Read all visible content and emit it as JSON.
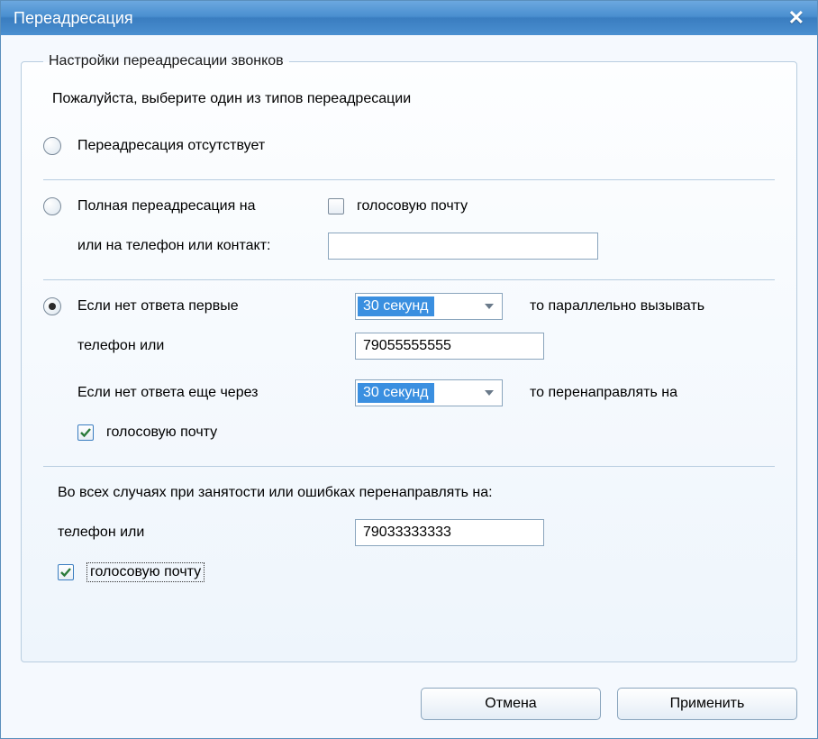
{
  "window": {
    "title": "Переадресация"
  },
  "group": {
    "legend": "Настройки переадресации звонков",
    "instruction": "Пожалуйста, выберите один из типов переадресации"
  },
  "option_none": {
    "label": "Переадресация отсутствует",
    "selected": false
  },
  "option_full": {
    "label": "Полная переадресация  на",
    "sub_label": "или на телефон или контакт:",
    "voicemail_checkbox": "голосовую почту",
    "voicemail_checked": false,
    "phone_value": "",
    "selected": false
  },
  "option_noanswer": {
    "line1_prefix": "Если нет ответа первые",
    "line1_suffix": "то параллельно вызывать",
    "timeout1": "30 секунд",
    "line2_label": "телефон или",
    "phone1_value": "79055555555",
    "line3_prefix": "Если нет ответа еще через",
    "line3_suffix": "то перенаправлять на",
    "timeout2": "30 секунд",
    "voicemail_checkbox": "голосовую почту",
    "voicemail_checked": true,
    "selected": true
  },
  "busy": {
    "heading": "Во всех случаях при занятости или ошибках перенаправлять на:",
    "phone_label": "телефон или",
    "phone_value": "79033333333",
    "voicemail_checkbox": "голосовую почту",
    "voicemail_checked": true
  },
  "buttons": {
    "cancel": "Отмена",
    "apply": "Применить"
  }
}
